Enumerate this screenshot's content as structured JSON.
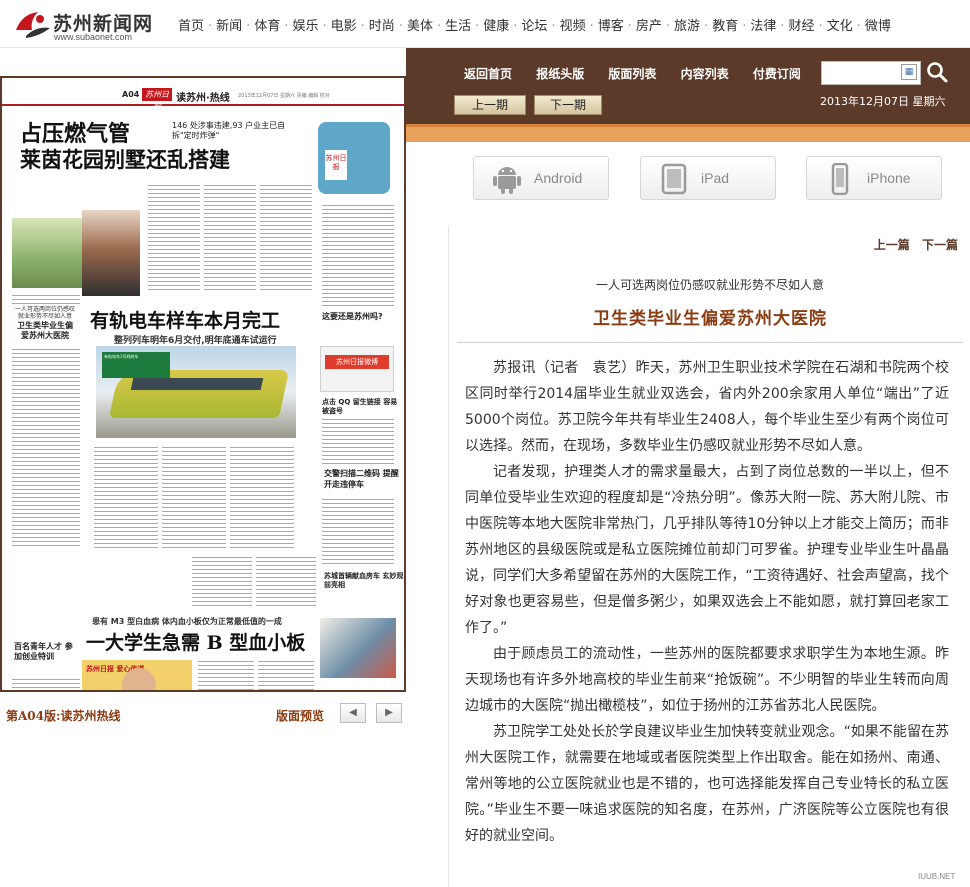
{
  "site": {
    "name": "苏州新闻网",
    "url": "www.subaonet.com",
    "nav": [
      "首页",
      "新闻",
      "体育",
      "娱乐",
      "电影",
      "时尚",
      "美体",
      "生活",
      "健康",
      "论坛",
      "视频",
      "博客",
      "房产",
      "旅游",
      "教育",
      "法律",
      "财经",
      "文化",
      "微博"
    ],
    "separator": "·"
  },
  "paper": {
    "page_code": "A04",
    "masthead": "苏州日报",
    "section": "读苏州·热线",
    "meta": "2013年12月07日 星期六 责编 编辑 校对",
    "headline1": "占压燃气管",
    "headline2": "莱茵花园别墅还乱搭建",
    "subhead1": "146 处涉事违建,93 户业主已自拆\"定时炸弹\"",
    "badge_text": "苏州日报",
    "headline3": "有轨电车样车本月完工",
    "subhead3": "整列列车明年6月交付,明年底通车试运行",
    "small_head_a": "一人可选两岗位仍感叹就业形势不尽如人意",
    "small_head_b": "卫生类毕业生偏爱苏州大医院",
    "train_note": "有轨电车1号线样车",
    "side_head_c": "这要还是苏州吗?",
    "weibo_label": "苏州日报微博",
    "side_head_d": "点击 QQ 留生链接 容易被盗号",
    "side_head_e": "交警扫描二维码 提醒开走违停车",
    "side_head_f": "苏城首辆献血房车 玄妙观前亮相",
    "headline4_small": "患有 M3 型白血病 体内血小板仅为正常最低值的一成",
    "headline4": "一大学生急需 B 型血小板",
    "side_head_g": "百名青年人才 参加创业特训",
    "baby_ad": "苏州日报 爱心传递"
  },
  "pager": {
    "page_label": "第A04版:读苏州热线",
    "preview_label": "版面预览",
    "prev_symbol": "◀",
    "next_symbol": "▶"
  },
  "toolbar": {
    "nav": [
      "返回首页",
      "报纸头版",
      "版面列表",
      "内容列表",
      "付费订阅"
    ],
    "search_value": "",
    "calendar_symbol": "▦",
    "prev_issue": "上一期",
    "next_issue": "下一期",
    "date": "2013年12月07日 星期六"
  },
  "apps": [
    {
      "label": "Android",
      "icon": "android-icon"
    },
    {
      "label": "iPad",
      "icon": "tablet-icon"
    },
    {
      "label": "iPhone",
      "icon": "phone-icon"
    }
  ],
  "article": {
    "prev": "上一篇",
    "next": "下一篇",
    "subtitle": "一人可选两岗位仍感叹就业形势不尽如人意",
    "title": "卫生类毕业生偏爱苏州大医院",
    "paragraphs": [
      "苏报讯（记者　袁艺）昨天，苏州卫生职业技术学院在石湖和书院两个校区同时举行2014届毕业生就业双选会，省内外200余家用人单位“端出”了近5000个岗位。苏卫院今年共有毕业生2408人，每个毕业生至少有两个岗位可以选择。然而，在现场，多数毕业生仍感叹就业形势不尽如人意。",
      "记者发现，护理类人才的需求量最大，占到了岗位总数的一半以上，但不同单位受毕业生欢迎的程度却是“冷热分明”。像苏大附一院、苏大附儿院、市中医院等本地大医院非常热门，几乎排队等待10分钟以上才能交上简历；而非苏州地区的县级医院或是私立医院摊位前却门可罗雀。护理专业毕业生叶晶晶说，同学们大多希望留在苏州的大医院工作，“工资待遇好、社会声望高，找个好对象也更容易些，但是僧多粥少，如果双选会上不能如愿，就打算回老家工作了。”",
      "由于顾虑员工的流动性，一些苏州的医院都要求求职学生为本地生源。昨天现场也有许多外地高校的毕业生前来“抢饭碗”。不少明智的毕业生转而向周边城市的大医院“抛出橄榄枝”，如位于扬州的江苏省苏北人民医院。",
      "苏卫院学工处处长於学良建议毕业生加快转变就业观念。“如果不能留在苏州大医院工作，就需要在地域或者医院类型上作出取舍。能在如扬州、南通、常州等地的公立医院就业也是不错的，也可选择能发挥自己专业特长的私立医院。”毕业生不要一味追求医院的知名度，在苏州，广济医院等公立医院也有很好的就业空间。"
    ]
  },
  "watermark": "IUUB.NET",
  "colors": {
    "brown": "#5b3a29",
    "orange": "#e8a15a",
    "title_brown": "#8a3b12",
    "red": "#c4161c"
  }
}
